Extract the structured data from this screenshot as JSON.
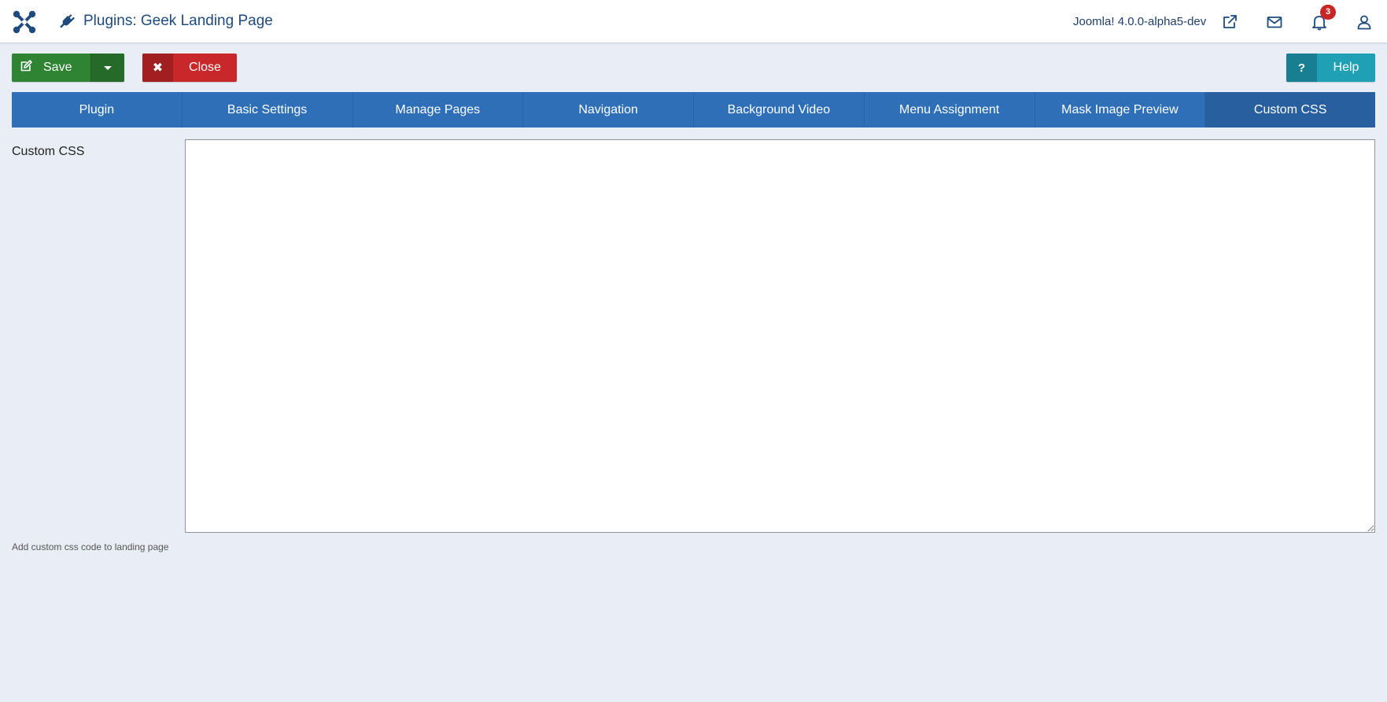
{
  "header": {
    "title": "Plugins: Geek Landing Page",
    "version": "Joomla! 4.0.0-alpha5-dev",
    "notification_count": "3",
    "icons": [
      "joomla-logo-icon",
      "plugin-icon",
      "external-link-icon",
      "mail-icon",
      "bell-icon",
      "user-icon"
    ]
  },
  "toolbar": {
    "save_label": "Save",
    "close_label": "Close",
    "close_icon": "✖",
    "help_label": "Help",
    "help_icon": "?"
  },
  "tabs": [
    {
      "label": "Plugin"
    },
    {
      "label": "Basic Settings"
    },
    {
      "label": "Manage Pages"
    },
    {
      "label": "Navigation"
    },
    {
      "label": "Background Video"
    },
    {
      "label": "Menu Assignment"
    },
    {
      "label": "Mask Image Preview"
    },
    {
      "label": "Custom CSS",
      "active": true
    }
  ],
  "form": {
    "label": "Custom CSS",
    "value": "",
    "description": "Add custom css code to landing page"
  },
  "colors": {
    "save": "#2f8433",
    "close": "#c8282a",
    "help": "#1fa0b5",
    "tabs": "#2e6fb7",
    "background": "#e9edf5",
    "badge": "#c52827"
  }
}
